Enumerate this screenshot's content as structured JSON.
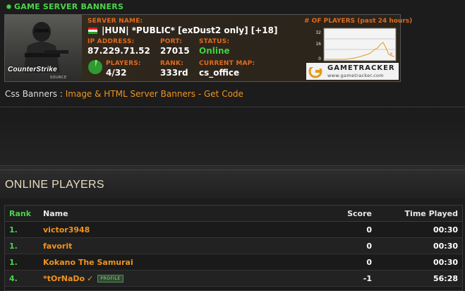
{
  "section1": {
    "title": "GAME SERVER BANNERS"
  },
  "banner": {
    "game_logo_text": "CounterStrike",
    "game_logo_sub": "SOURCE",
    "server_name_label": "SERVER NAME:",
    "server_name": "|HUN| *PUBLIC* [exDust2 only] [+18]",
    "ip_label": "IP ADDRESS:",
    "ip": "87.229.71.52",
    "port_label": "PORT:",
    "port": "27015",
    "status_label": "STATUS:",
    "status": "Online",
    "players_label": "PLAYERS:",
    "players": "4/32",
    "rank_label": "RANK:",
    "rank": "333rd",
    "map_label": "CURRENT MAP:",
    "map": "cs_office",
    "graph_title": "# OF PLAYERS (past 24 hours)",
    "graph_yticks": [
      "32",
      "16",
      "0"
    ],
    "gametracker_name": "GAMETRACKER",
    "gametracker_url": "www.gametracker.com",
    "colors": {
      "label": "#e06a1e",
      "online": "#3fd13f"
    }
  },
  "code_line": {
    "prefix": "Css Banners : ",
    "link": "Image & HTML Server Banners - Get Code"
  },
  "online_players": {
    "title": "ONLINE PLAYERS",
    "columns": {
      "rank": "Rank",
      "name": "Name",
      "score": "Score",
      "time": "Time Played"
    },
    "rows": [
      {
        "rank": "1.",
        "name": "victor3948",
        "score": "0",
        "time": "00:30"
      },
      {
        "rank": "1.",
        "name": "favorit",
        "score": "0",
        "time": "00:30"
      },
      {
        "rank": "1.",
        "name": "Kokano The Samurai",
        "score": "0",
        "time": "00:30"
      },
      {
        "rank": "4.",
        "name": "*tOrNaDo",
        "score": "-1",
        "time": "56:28",
        "verified": "✓",
        "badge": "PROFILE"
      }
    ]
  }
}
